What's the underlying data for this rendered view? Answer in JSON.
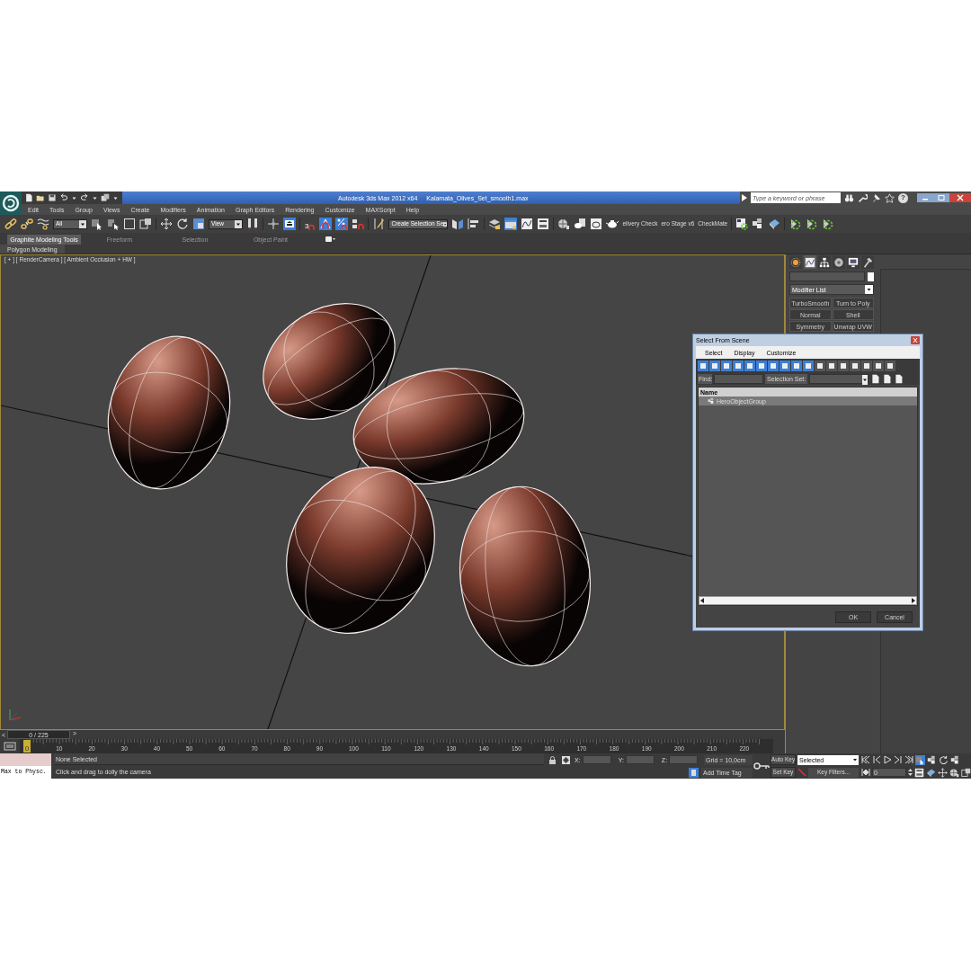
{
  "title_bar": {
    "title": "Autodesk 3ds Max  2012 x64",
    "file": "Kalamata_Olives_Set_smooth1.max",
    "search": {
      "placeholder": "Type a keyword or phrase"
    },
    "help": "?"
  },
  "menu": [
    "Edit",
    "Tools",
    "Group",
    "Views",
    "Create",
    "Modifiers",
    "Animation",
    "Graph Editors",
    "Rendering",
    "Customize",
    "MAXScript",
    "Help"
  ],
  "main_toolbar": [
    {
      "kind": "icon",
      "active": false
    },
    {
      "kind": "icon",
      "active": false
    },
    {
      "kind": "icon",
      "active": false
    },
    {
      "kind": "dropdown",
      "value": "All"
    },
    {
      "kind": "icon",
      "active": false
    },
    {
      "kind": "icon",
      "active": false
    },
    {
      "kind": "icon",
      "active": false
    },
    {
      "kind": "icon",
      "active": false
    },
    {
      "kind": "separator"
    },
    {
      "kind": "icon",
      "active": false
    },
    {
      "kind": "icon",
      "active": false
    },
    {
      "kind": "icon",
      "active": false
    },
    {
      "kind": "dropdown",
      "value": "View"
    },
    {
      "kind": "icon",
      "active": false
    },
    {
      "kind": "separator"
    },
    {
      "kind": "icon",
      "active": false
    },
    {
      "kind": "icon",
      "active": true
    },
    {
      "kind": "separator"
    },
    {
      "kind": "labeled",
      "label": "3",
      "active": false
    },
    {
      "kind": "icon",
      "active": true
    },
    {
      "kind": "icon",
      "active": true
    },
    {
      "kind": "icon",
      "active": false
    },
    {
      "kind": "separator"
    },
    {
      "kind": "icon",
      "active": false
    },
    {
      "kind": "dropdown",
      "value": "Create Selection Se"
    },
    {
      "kind": "icon",
      "active": false
    },
    {
      "kind": "icon",
      "active": false
    },
    {
      "kind": "separator"
    },
    {
      "kind": "icon",
      "active": false
    },
    {
      "kind": "icon",
      "active": true
    },
    {
      "kind": "icon",
      "active": false
    },
    {
      "kind": "icon",
      "active": false
    },
    {
      "kind": "separator"
    },
    {
      "kind": "icon",
      "active": false
    },
    {
      "kind": "icon",
      "active": false
    },
    {
      "kind": "icon",
      "active": false
    },
    {
      "kind": "icon",
      "active": false
    },
    {
      "kind": "text",
      "label": "elivery Check"
    },
    {
      "kind": "text",
      "label": "ero Stage v6"
    },
    {
      "kind": "text",
      "label": "CheckMate"
    },
    {
      "kind": "separator"
    },
    {
      "kind": "icon",
      "active": false
    },
    {
      "kind": "icon",
      "active": false
    },
    {
      "kind": "icon",
      "active": false
    },
    {
      "kind": "separator"
    },
    {
      "kind": "icon",
      "active": false
    },
    {
      "kind": "icon",
      "active": false
    },
    {
      "kind": "icon",
      "active": false
    }
  ],
  "ribbon": {
    "tabs": [
      {
        "label": "Graphite Modeling Tools",
        "selected": true
      },
      {
        "label": "Freeform",
        "selected": false
      },
      {
        "label": "Selection",
        "selected": false
      },
      {
        "label": "Object Paint",
        "selected": false
      }
    ],
    "panel": "Polygon Modeling"
  },
  "viewport": {
    "label": "[ + ] [ RenderCamera ] [ Ambient Occlusion + HW ]"
  },
  "command_panel": {
    "tabs": [
      {
        "selected": false
      },
      {
        "selected": true
      },
      {
        "selected": false
      },
      {
        "selected": false
      },
      {
        "selected": false
      },
      {
        "selected": false
      }
    ],
    "modifier_list": "Modifier List",
    "modifier_buttons": [
      "TurboSmooth",
      "Turn to Poly",
      "Normal",
      "Shell",
      "Symmetry",
      "Unwrap UVW"
    ]
  },
  "timeline": {
    "prev": "<",
    "slider": "0 / 225",
    "next": ">",
    "marker": "0",
    "labels": [
      "10",
      "20",
      "30",
      "40",
      "50",
      "60",
      "70",
      "80",
      "90",
      "100",
      "110",
      "120",
      "130",
      "140",
      "150",
      "160",
      "170",
      "180",
      "190",
      "200",
      "210",
      "220"
    ]
  },
  "status": {
    "script_output": "Max to Physc.",
    "selection": "None Selected",
    "prompt": "Click and drag to dolly the camera",
    "x": "X:",
    "y": "Y:",
    "z": "Z:",
    "grid": "Grid = 10,0cm",
    "time_tag": "Add Time Tag",
    "auto_key": "Auto Key",
    "key_set": "Selected",
    "set_key": "Set Key",
    "key_filters": "Key Filters...",
    "frame": "0"
  },
  "dialog": {
    "title": "Select From Scene",
    "menu": [
      "Select",
      "Display",
      "Customize"
    ],
    "toolbar": [
      {
        "active": true
      },
      {
        "active": true
      },
      {
        "active": true
      },
      {
        "active": true
      },
      {
        "active": true
      },
      {
        "active": true
      },
      {
        "active": true
      },
      {
        "active": true
      },
      {
        "active": true
      },
      {
        "active": true
      },
      {
        "active": false
      },
      {
        "active": false
      },
      {
        "active": false
      },
      {
        "active": false
      },
      {
        "active": false
      },
      {
        "active": false
      },
      {
        "active": false
      }
    ],
    "find": "Find:",
    "selection_set": "Selection Set:",
    "column": "Name",
    "rows": [
      {
        "label": "HeroObjectGroup",
        "selected": true
      }
    ],
    "buttons": [
      "OK",
      "Cancel"
    ]
  }
}
